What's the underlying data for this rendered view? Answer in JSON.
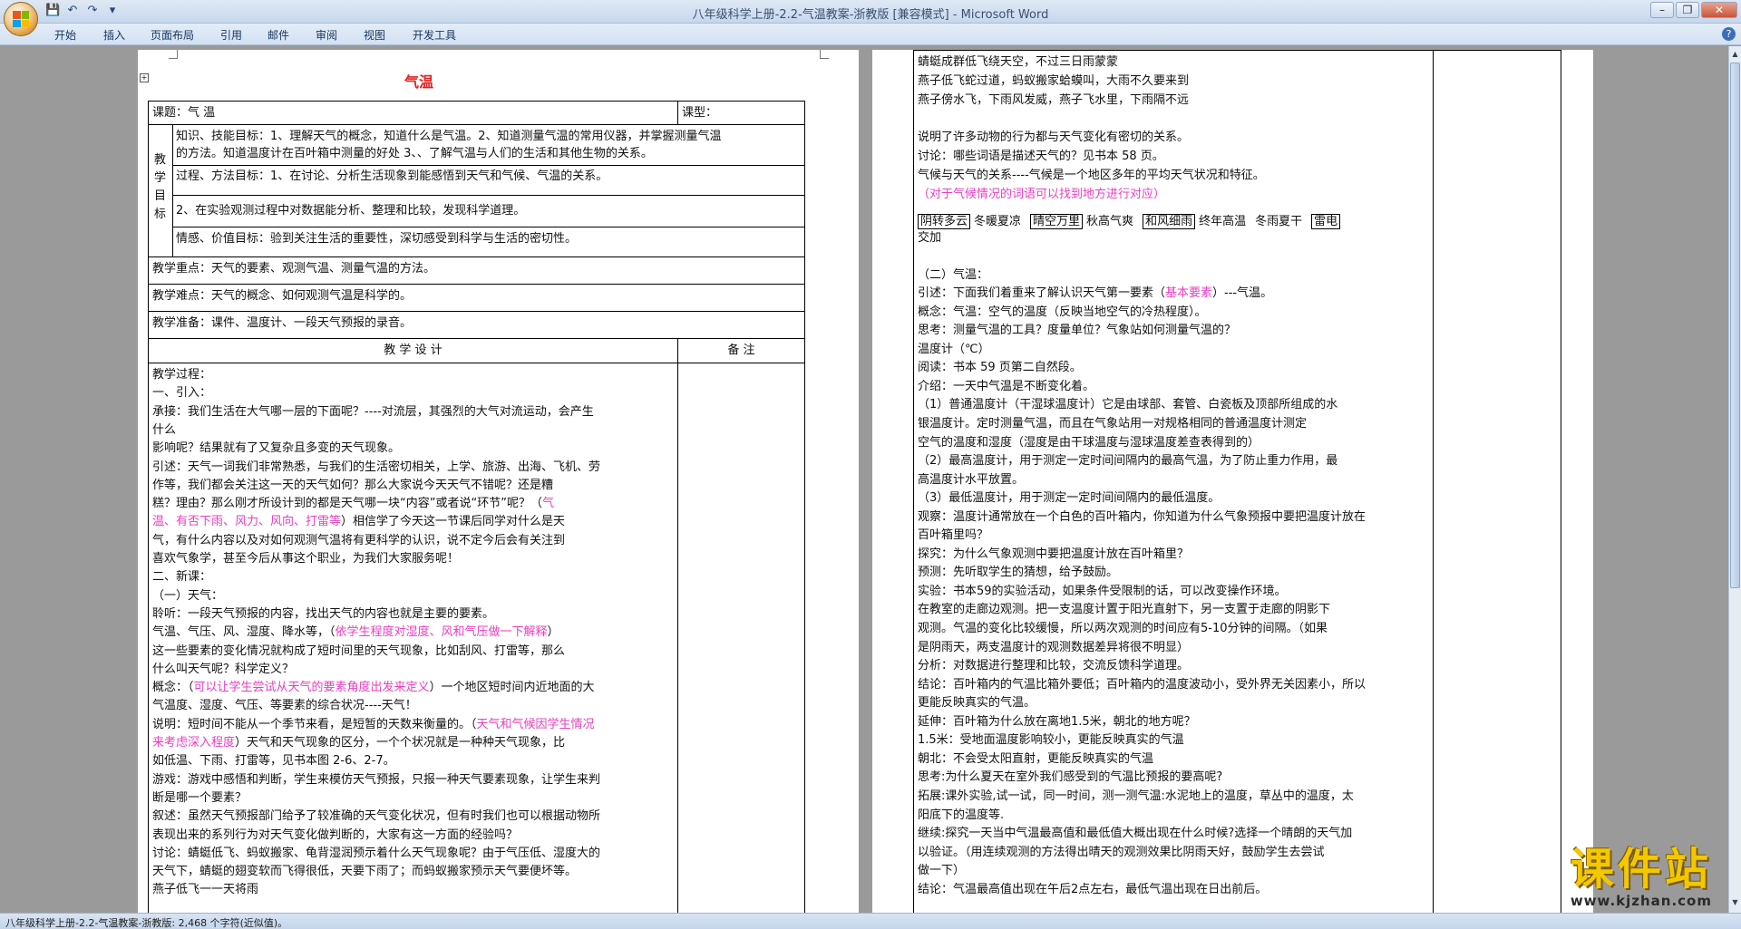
{
  "window": {
    "title": "八年级科学上册-2.2-气温教案-浙教版 [兼容模式] - Microsoft Word"
  },
  "qat": {
    "save": "💾",
    "undo": "↶",
    "redo": "↷",
    "more": "▾"
  },
  "ribbon": {
    "tabs": [
      "开始",
      "插入",
      "页面布局",
      "引用",
      "邮件",
      "审阅",
      "视图",
      "开发工具"
    ],
    "help": "?"
  },
  "status": {
    "text": "八年级科学上册-2.2-气温教案-浙教版: 2,468 个字符(近似值)。"
  },
  "page1": {
    "title": "气温",
    "lesson": "课题：气 温",
    "type": "课型：",
    "goals_head": "教学目标",
    "goal1": "知识、技能目标：1、理解天气的概念，知道什么是气温。2、知道测量气温的常用仪器，并掌握测量气温",
    "goal1b": "的方法。知道温度计在百叶箱中测量的好处   3、、了解气温与人们的生活和其他生物的关系。",
    "goal2": "过程、方法目标：1、在讨论、分析生活现象到能感悟到天气和气候、气温的关系。",
    "goal2b": "2、在实验观测过程中对数据能分析、整理和比较，发现科学道理。",
    "goal3": "情感、价值目标：验到关注生活的重要性，深切感受到科学与生活的密切性。",
    "key": "教学重点：天气的要素、观测气温、测量气温的方法。",
    "difficult": "教学难点：天气的概念、如何观测气温是科学的。",
    "prep": "教学准备：课件、温度计、一段天气预报的录音。",
    "design": "教 学 设 计",
    "notes": "备  注",
    "lines": [
      {
        "t": "教学过程："
      },
      {
        "t": "一、引入："
      },
      {
        "t": "  承接：我们生活在大气哪一层的下面呢？----对流层，其强烈的大气对流运动，会产生"
      },
      {
        "t": "             什么"
      },
      {
        "t": "         影响呢？结果就有了又复杂且多变的天气现象。"
      },
      {
        "t": "  引述：天气一词我们非常熟悉，与我们的生活密切相关，上学、旅游、出海、飞机、劳"
      },
      {
        "t": "         作等，我们都会关注这一天的天气如何？那么大家说今天天气不错呢？还是糟"
      },
      {
        "t": "         糕？理由？那么刚才所设计到的都是天气哪一块“内容”或者说“环节”呢？（",
        "p": "气"
      },
      {
        "p": "         温、有否下雨、风力、风向、打雷等",
        "t2": "）相信学了今天这一节课后同学对什么是天"
      },
      {
        "t": "         气，有什么内容以及对如何观测气温将有更科学的认识，说不定今后会有关注到"
      },
      {
        "t": "         喜欢气象学，甚至今后从事这个职业，为我们大家服务呢！"
      },
      {
        "t": "二、新课："
      },
      {
        "t": "（一）天气："
      },
      {
        "t": "聆听：一段天气预报的内容，找出天气的内容也就是主要的要素。"
      },
      {
        "t": "         气温、气压、风、湿度、降水等，（",
        "p": "依学生程度对湿度、风和气压做一下解释",
        "t2": "）"
      },
      {
        "t": "         这一些要素的变化情况就构成了短时间里的天气现象，比如刮风、打雷等，那么"
      },
      {
        "t": "         什么叫天气呢？科学定义？"
      },
      {
        "t": "概念：（",
        "p": "可以让学生尝试从天气的要素角度出发来定义",
        "t2": "）一个地区短时间内近地面的大"
      },
      {
        "t": "         气温度、湿度、气压、等要素的综合状况----天气！"
      },
      {
        "t": "说明：短时间不能从一个季节来看，是短暂的天数来衡量的。（",
        "p": "天气和气候因学生情况"
      },
      {
        "p": "         来考虑深入程度",
        "t2": "）天气和天气现象的区分，一个个状况就是一种种天气现象，比"
      },
      {
        "t": "         如低温、下雨、打雷等，见书本图 2-6、2-7。"
      },
      {
        "t": "游戏：游戏中感悟和判断，学生来模仿天气预报，只报一种天气要素现象，让学生来判"
      },
      {
        "t": "         断是哪一个要素？"
      },
      {
        "t": "叙述：虽然天气预报部门给予了较准确的天气变化状况，但有时我们也可以根据动物所"
      },
      {
        "t": "         表现出来的系列行为对天气变化做判断的，大家有这一方面的经验吗？"
      },
      {
        "t": "讨论：蜻蜓低飞、蚂蚁搬家、龟背湿润预示着什么天气现象呢？由于气压低、湿度大的"
      },
      {
        "t": "         天气下，蜻蜓的翅变软而飞得很低，天要下雨了；而蚂蚁搬家预示天气要便坏等。"
      },
      {
        "t": "         燕子低飞一一天将雨"
      }
    ]
  },
  "page2": {
    "lines": [
      {
        "t": "            蜻蜓成群低飞绕天空，不过三日雨蒙蒙"
      },
      {
        "t": "            燕子低飞蛇过道，蚂蚁搬家蛤蟆叫，大雨不久要来到"
      },
      {
        "t": "            燕子傍水飞，下雨风发威，燕子飞水里，下雨隔不远"
      },
      {
        "t": ""
      },
      {
        "t": "        说明了许多动物的行为都与天气变化有密切的关系。"
      },
      {
        "t": "讨论：哪些词语是描述天气的？见书本 58 页。"
      },
      {
        "t": "        气候与天气的关系----气候是一个地区多年的平均天气状况和特征。"
      },
      {
        "p": "             （对于气候情况的词语可以找到地方进行对应）"
      }
    ],
    "words": [
      "阴转多云",
      "冬暖夏凉",
      "晴空万里",
      "秋高气爽",
      "和风细雨",
      "终年高温",
      "冬雨夏干",
      "雷电"
    ],
    "words_end": "交加",
    "lines2": [
      {
        "t": ""
      },
      {
        "t": "（二）气温："
      },
      {
        "t": "引述：下面我们着重来了解认识天气第一要素（",
        "p": "基本要素",
        "t2": "）---气温。"
      },
      {
        "t": "概念：气温：空气的温度（反映当地空气的冷热程度）。"
      },
      {
        "t": "思考：测量气温的工具？度量单位？气象站如何测量气温的？"
      },
      {
        "t": "        温度计（℃）"
      },
      {
        "t": "阅读：书本 59 页第二自然段。"
      },
      {
        "t": "介绍：一天中气温是不断变化着。"
      },
      {
        "t": "        （1）普通温度计（干湿球温度计）它是由球部、套管、白瓷板及顶部所组成的水"
      },
      {
        "t": "             银温度计。定时测量气温，而且在气象站用一对规格相同的普通温度计测定"
      },
      {
        "t": "             空气的温度和湿度（湿度是由干球温度与湿球温度差查表得到的）"
      },
      {
        "t": "        （2）最高温度计，用于测定一定时间间隔内的最高气温，为了防止重力作用，最"
      },
      {
        "t": "             高温度计水平放置。"
      },
      {
        "t": "        （3）最低温度计，用于测定一定时间间隔内的最低温度。"
      },
      {
        "t": "观察：温度计通常放在一个白色的百叶箱内，你知道为什么气象预报中要把温度计放在"
      },
      {
        "t": "        百叶箱里吗？"
      },
      {
        "t": "探究：为什么气象观测中要把温度计放在百叶箱里？"
      },
      {
        "t": "预测：先听取学生的猜想，给予鼓励。"
      },
      {
        "t": "实验：书本59的实验活动，如果条件受限制的话，可以改变操作环境。"
      },
      {
        "t": "        在教室的走廊边观测。把一支温度计置于阳光直射下，另一支置于走廊的阴影下"
      },
      {
        "t": "        观测。气温的变化比较缓慢，所以两次观测的时间应有5-10分钟的间隔。（如果"
      },
      {
        "t": "        是阴雨天，两支温度计的观测数据差异将很不明显）"
      },
      {
        "t": "分析：对数据进行整理和比较，交流反馈科学道理。"
      },
      {
        "t": "结论：百叶箱内的气温比箱外要低；百叶箱内的温度波动小，受外界无关因素小，所以"
      },
      {
        "t": "        更能反映真实的气温。"
      },
      {
        "t": "延伸：百叶箱为什么放在离地1.5米，朝北的地方呢？"
      },
      {
        "t": "        1.5米：受地面温度影响较小，更能反映真实的气温"
      },
      {
        "t": "        朝北：不会受太阳直射，更能反映真实的气温"
      },
      {
        "t": "思考:为什么夏天在室外我们感受到的气温比预报的要高呢?"
      },
      {
        "t": "拓展:课外实验,试一试，同一时间，测一测气温:水泥地上的温度，草丛中的温度，太"
      },
      {
        "t": "        阳底下的温度等."
      },
      {
        "t": "继续:探究一天当中气温最高值和最低值大概出现在什么时候?选择一个晴朗的天气加"
      },
      {
        "t": "        以验证。（用连续观测的方法得出晴天的观测效果比阴雨天好，鼓励学生去尝试"
      },
      {
        "t": "        做一下）"
      },
      {
        "t": "结论：气温最高值出现在午后2点左右，最低气温出现在日出前后。"
      }
    ]
  },
  "watermark": {
    "big": "课件站",
    "small": "www.kjzhan.com"
  },
  "colors": {
    "accent_pink": "#e83fbf",
    "title_red": "#e02020",
    "watermark_yellow": "#f4c800"
  }
}
